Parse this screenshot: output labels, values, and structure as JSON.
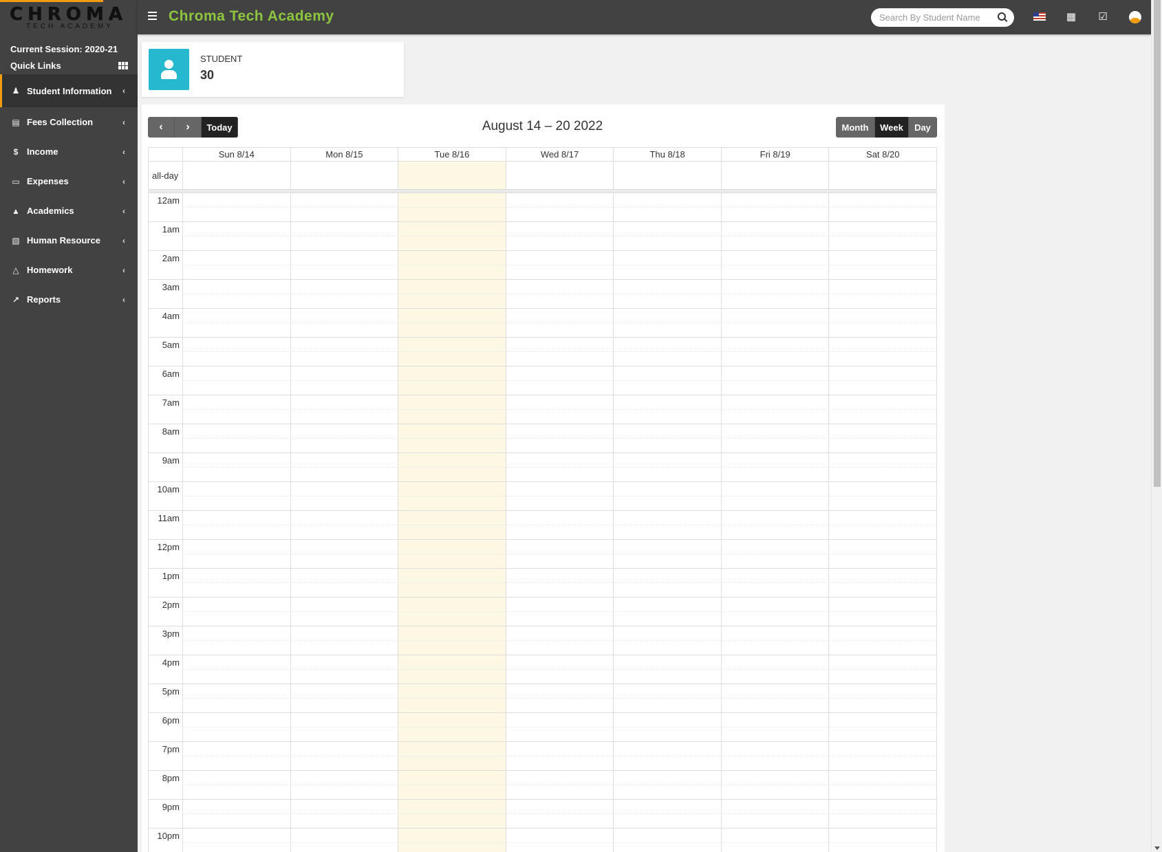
{
  "app": {
    "logo_main": "CHROMA",
    "logo_sub": "TECH ACADEMY",
    "brand_title": "Chroma Tech Academy",
    "accent_color": "#8dc63f",
    "sidebar_color": "#424242",
    "highlight_color": "#f39c12"
  },
  "sidebar": {
    "session_label": "Current Session: 2020-21",
    "quick_links_label": "Quick Links",
    "items": [
      {
        "label": "Student Information",
        "icon": "user-plus-icon",
        "active": true
      },
      {
        "label": "Fees Collection",
        "icon": "money-icon"
      },
      {
        "label": "Income",
        "icon": "dollar-icon"
      },
      {
        "label": "Expenses",
        "icon": "credit-card-icon"
      },
      {
        "label": "Academics",
        "icon": "graduation-cap-icon"
      },
      {
        "label": "Human Resource",
        "icon": "sitemap-icon"
      },
      {
        "label": "Homework",
        "icon": "flask-icon"
      },
      {
        "label": "Reports",
        "icon": "line-chart-icon"
      }
    ]
  },
  "topbar": {
    "search_placeholder": "Search By Student Name",
    "icons": [
      "flag-us-icon",
      "calendar-icon",
      "check-square-icon",
      "user-avatar-icon"
    ]
  },
  "stat_card": {
    "label": "STUDENT",
    "value": "30",
    "icon": "user-icon",
    "color": "#25b8cf"
  },
  "calendar": {
    "title": "August 14 – 20 2022",
    "prev_icon": "chevron-left-icon",
    "next_icon": "chevron-right-icon",
    "today_label": "Today",
    "views": [
      "Month",
      "Week",
      "Day"
    ],
    "active_view": "Week",
    "allday_label": "all-day",
    "days": [
      "Sun 8/14",
      "Mon 8/15",
      "Tue 8/16",
      "Wed 8/17",
      "Thu 8/18",
      "Fri 8/19",
      "Sat 8/20"
    ],
    "today_index": 2,
    "today_color": "#fcf8e3",
    "hours": [
      "12am",
      "1am",
      "2am",
      "3am",
      "4am",
      "5am",
      "6am",
      "7am",
      "8am",
      "9am",
      "10am",
      "11am",
      "12pm",
      "1pm",
      "2pm",
      "3pm",
      "4pm",
      "5pm",
      "6pm",
      "7pm",
      "8pm",
      "9pm",
      "10pm"
    ]
  }
}
